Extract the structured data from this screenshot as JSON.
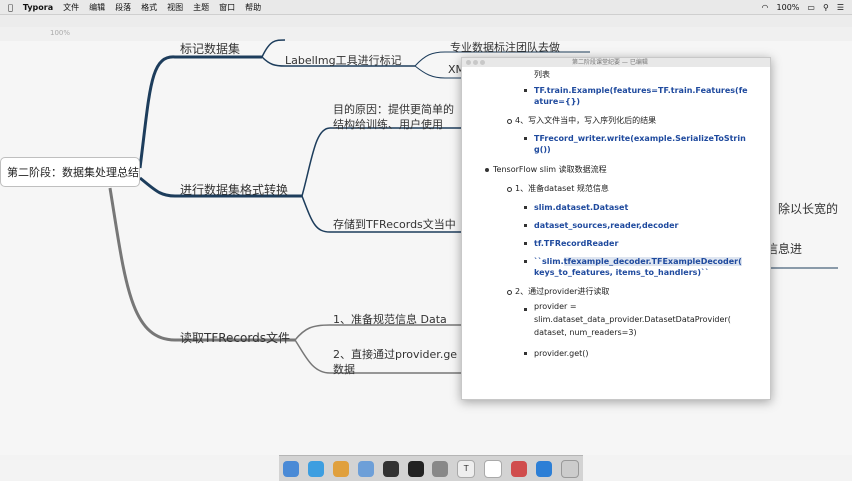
{
  "menubar": {
    "apple": "",
    "items": [
      "Typora",
      "文件",
      "编辑",
      "段落",
      "格式",
      "视图",
      "主题",
      "窗口",
      "帮助"
    ],
    "battery": "100%",
    "wifi_label": "wifi-icon"
  },
  "background": {
    "zoom": "100%"
  },
  "mindmap": {
    "root": "第二阶段：数据集处理总结",
    "branches": [
      "标记数据集",
      "进行数据集格式转换",
      "读取TFRecords文件"
    ],
    "sub": {
      "labelimg": "LabelImg工具进行标记",
      "team": "专业数据标注团队去做",
      "xml": "XM",
      "purpose_line1": "目的原因：提供更简单的",
      "purpose_line2": "结构给训练、用户使用",
      "store": "存储到TFRecords文当中",
      "read1": "1、准备规范信息 Data",
      "read2_line1": "2、直接通过provider.ge",
      "read2_line2": "数据",
      "right1": "、除以长宽的",
      "right2": "信息进"
    }
  },
  "popup": {
    "title": "第二阶段课堂纪要 — 已编辑",
    "lines": {
      "l1": "列表",
      "l2": "TF.train.Example(features=TF.train.Features(fe",
      "l3": "ature={})",
      "l4": "4、写入文件当中，写入序列化后的结果",
      "l5": "TFrecord_writer.write(example.SerializeToStrin",
      "l6": "g())",
      "l7": "TensorFlow slim 读取数据流程",
      "l8": "1、准备dataset 规范信息",
      "l9": "slim.dataset.Dataset",
      "l10": "dataset_sources,reader,decoder",
      "l11": "tf.TFRecordReader",
      "l12a": "``slim.",
      "l12b": "tfexample_decoder.TFExampleDecoder(",
      "l13": "keys_to_features, items_to_handlers)``",
      "l14": "2、通过provider进行读取",
      "l15": "provider =",
      "l16": "slim.dataset_data_provider.DatasetDataProvider(",
      "l17": "dataset, num_readers=3)",
      "l18": "provider.get()"
    }
  },
  "dock": {
    "apps": [
      "Finder",
      "Safari",
      "Chrome",
      "Mail",
      "PyCharm",
      "Terminal",
      "Photos",
      "Typora",
      "Typora2",
      "Preview",
      "QQ",
      "Trash"
    ]
  },
  "colors": {
    "branch": "#1d3d5c",
    "branch2": "#777777",
    "code_blue": "#1f4a9e"
  }
}
